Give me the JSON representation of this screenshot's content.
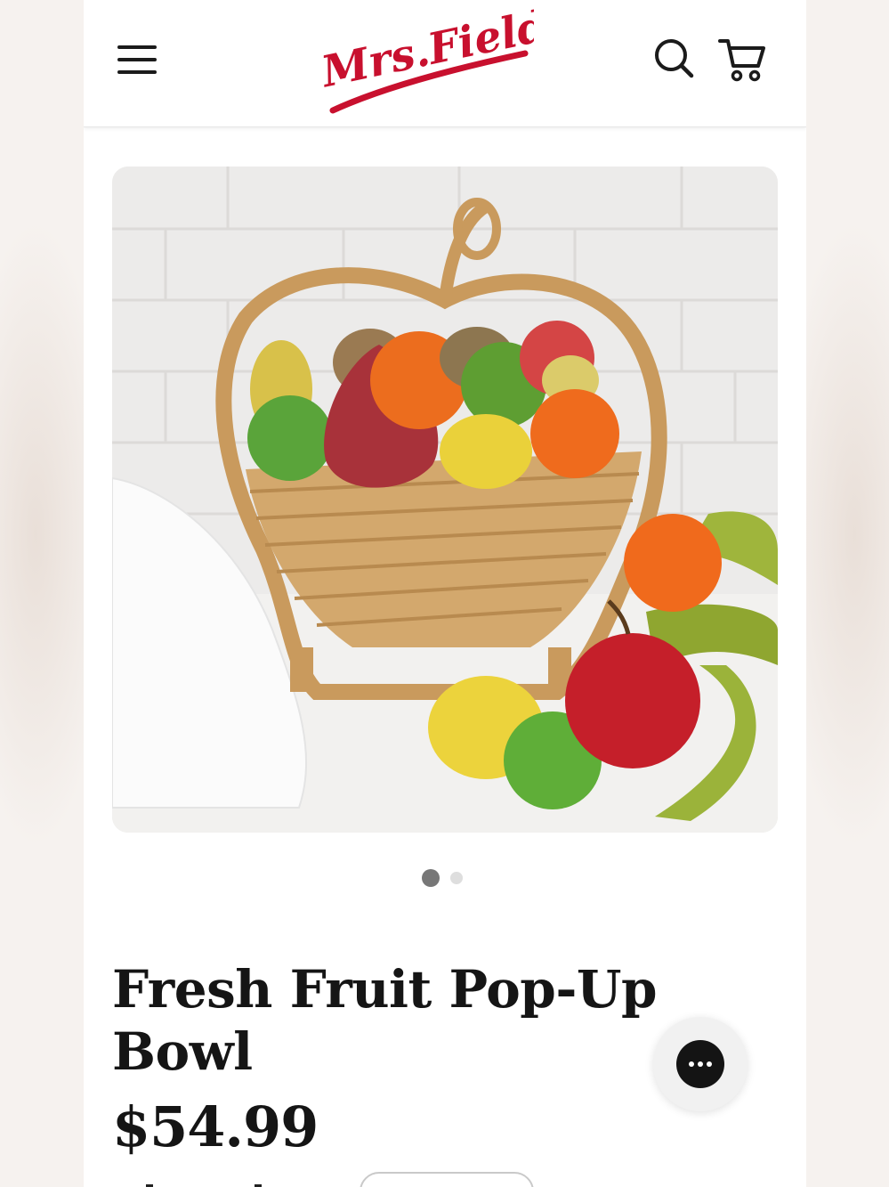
{
  "header": {
    "menu_icon": "hamburger-menu-icon",
    "logo_text": "Mrs.Fields",
    "search_icon": "search-icon",
    "cart_icon": "shopping-cart-icon"
  },
  "gallery": {
    "image_alt": "Fresh Fruit Pop-Up Bowl",
    "slide_count": 2,
    "active_slide": 1
  },
  "product": {
    "title": "Fresh Fruit Pop-Up Bowl",
    "price": "$54.99"
  },
  "chat": {
    "icon": "chat-ellipsis-icon"
  },
  "colors": {
    "brand_red": "#c8102e",
    "text": "#151515",
    "dot_active": "#777777",
    "dot_inactive": "#dedede"
  }
}
